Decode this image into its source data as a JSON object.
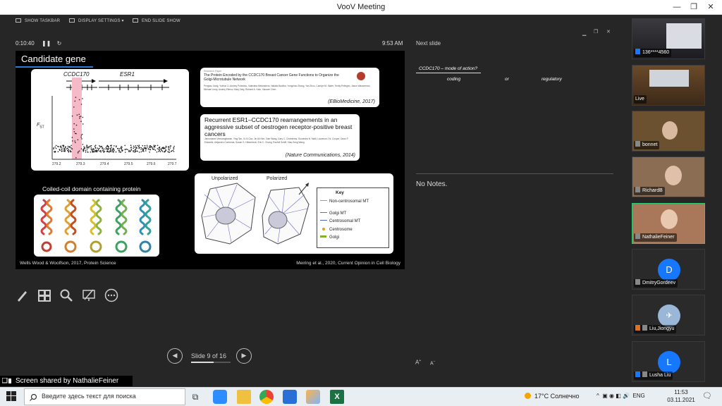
{
  "window": {
    "title": "VooV Meeting"
  },
  "toolbar": {
    "show_taskbar": "SHOW TASKBAR",
    "display_settings": "DISPLAY SETTINGS ▾",
    "end_show": "END SLIDE SHOW"
  },
  "presenter": {
    "timer": "0:10:40",
    "clock": "9:53 AM",
    "next_slide_label": "Next slide",
    "notes": "No Notes.",
    "slide_counter": "Slide 9 of 16",
    "slide_progress": 0.5625,
    "font_up": "A",
    "font_down": "A"
  },
  "slide": {
    "title": "Candidate gene",
    "plot": {
      "gene1": "CCDC170",
      "gene2": "ESR1",
      "ylabel": "F",
      "ylabel_sub": "ST",
      "xticks": [
        "279.2",
        "279.3",
        "279.4",
        "279.5",
        "279.6",
        "279.7"
      ]
    },
    "paper1": {
      "tag": "Research Paper",
      "title": "The Protein Encoded by the CCDC170 Breast Cancer Gene Functions to Organize the Golgi-Microtubule Network",
      "authors": "Pengtao Jiang, Yuerun Li, Andrey Poleshko, Valentina Medvedeva, Natalia Baulina, Yongchao Zhang, Yan Zhou, Carolyn M. Slater, Trinity Pellegrin, Jason Wasserman, Michael Lindy, Andrey Efimov, Mary Daly, Richard A. Katz, Xiaowei Chen",
      "citation": "(EBioMedicine, 2017)"
    },
    "paper2": {
      "title": "Recurrent ESR1–CCDC170 rearrangements in an aggressive subset of oestrogen receptor-positive breast cancers",
      "authors": "Jamunarani Veeraraghavan, Ying Tan, Xi-Xi Cao, Jin Ah Kim, Xian Wang, Gary C. Chamness, Sourindra N. Maiti, Laurence J.N. Cooper, Dean P. Edwards, Alejandro Contreras, Susan G. Hilsenbeck, Eric C. Chang, Rachel Schiff, Xiao-Song Wang",
      "citation": "(Nature Communications, 2014)"
    },
    "coil_label": "Coiled-coil domain containing protein",
    "cells": {
      "unpolarized": "Unpolarized",
      "polarized": "Polarized"
    },
    "key": {
      "title": "Key",
      "items": [
        "Non-centrosomal MT",
        "Golgi MT",
        "Centrosomal MT",
        "Centrosome",
        "Golgi"
      ]
    },
    "caption_left": "Wells Wood & Woolfson, 2017, Protein Science",
    "caption_right": "Meiring et al., 2020, Current Opinion in Cell Biology"
  },
  "next_slide": {
    "title": "CCDC170 – mode of action?",
    "words": [
      "coding",
      "or",
      "regulatory"
    ]
  },
  "participants": [
    {
      "name": "136****4560",
      "type": "video"
    },
    {
      "name": "Live",
      "type": "video"
    },
    {
      "name": "bonnet",
      "type": "video"
    },
    {
      "name": "RichardB",
      "type": "video"
    },
    {
      "name": "NathalieFeiner",
      "type": "video",
      "active": true
    },
    {
      "name": "DmitryGordeev",
      "type": "avatar",
      "initial": "D"
    },
    {
      "name": "Liu,Jiongyu",
      "type": "avatar-img"
    },
    {
      "name": "Lusha Liu",
      "type": "avatar",
      "initial": "L"
    }
  ],
  "share_bar": "Screen shared by NathalieFeiner",
  "taskbar": {
    "search_placeholder": "Введите здесь текст для поиска",
    "weather": "17°C  Солнечно",
    "lang": "ENG",
    "time": "11:53",
    "date": "03.11.2021"
  },
  "colors": {
    "accent": "#2b7bd6",
    "active_border": "#2ecc71",
    "avatar_blue": "#1677ff"
  }
}
